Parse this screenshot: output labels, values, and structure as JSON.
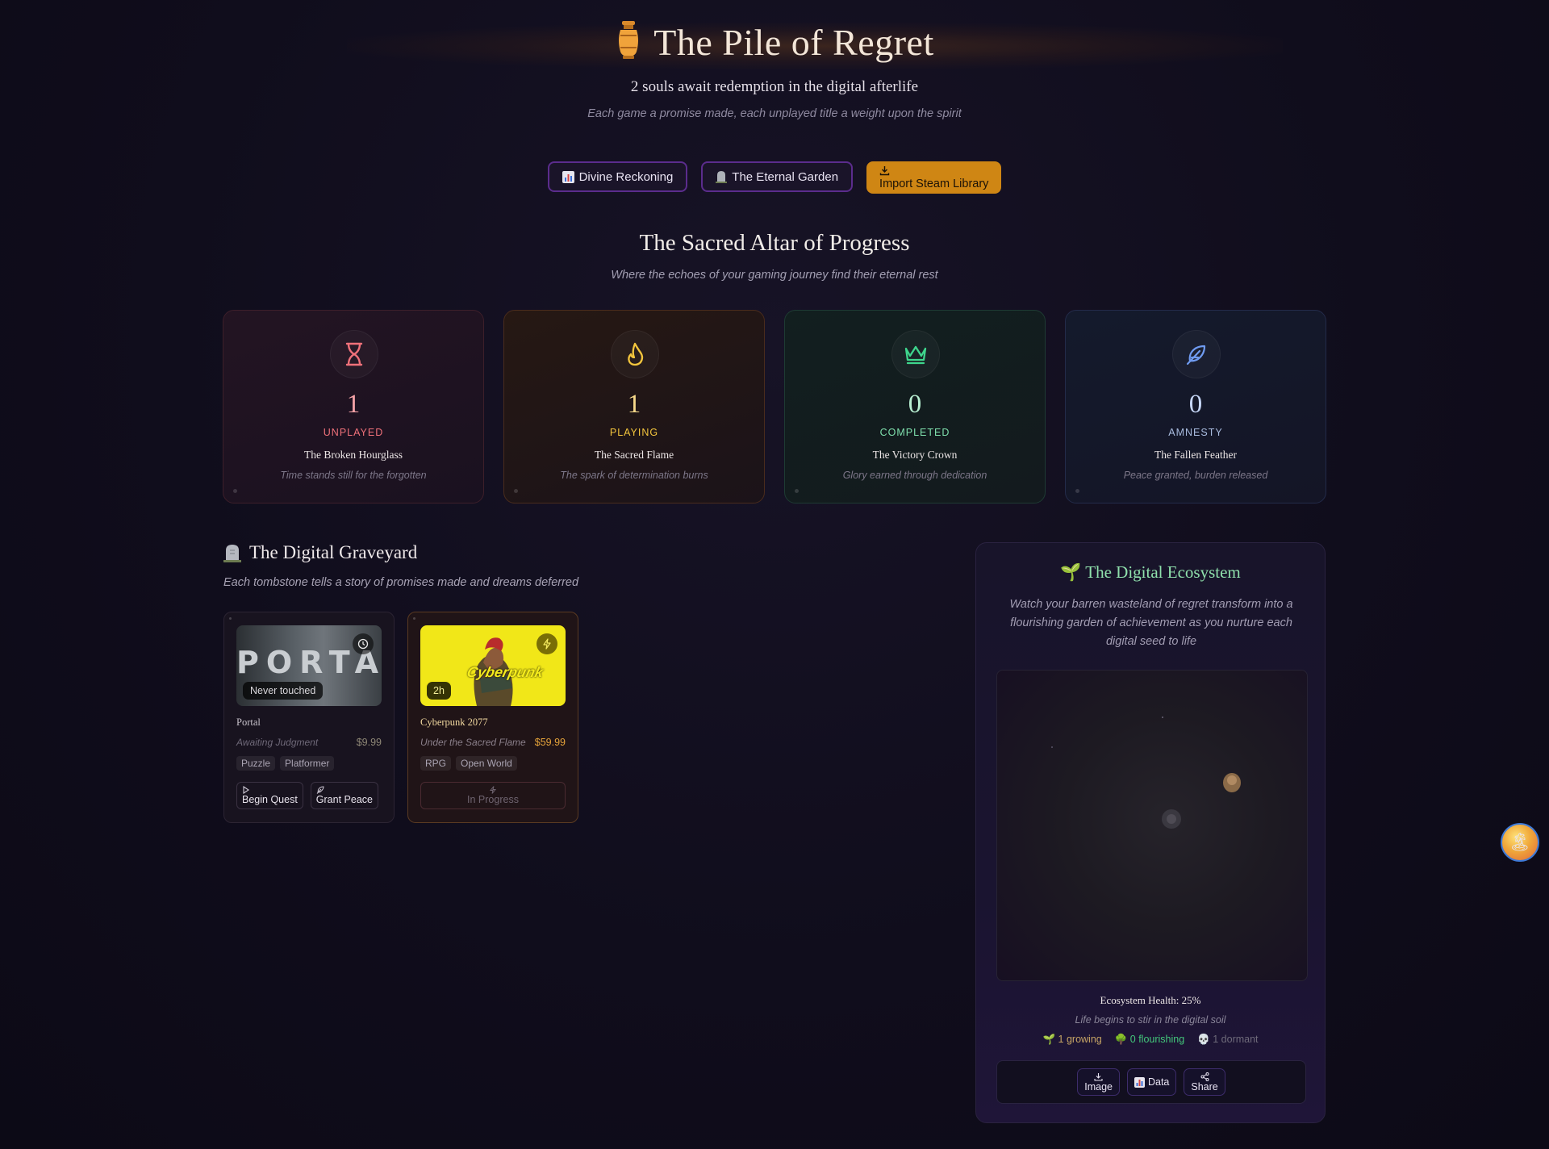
{
  "header": {
    "title": "The Pile of Regret",
    "subtitle": "2 souls await redemption in the digital afterlife",
    "tagline": "Each game a promise made, each unplayed title a weight upon the spirit"
  },
  "top_buttons": {
    "reckoning": "Divine Reckoning",
    "garden": "The Eternal Garden",
    "import": "Import Steam Library"
  },
  "altar": {
    "title": "The Sacred Altar of Progress",
    "subtitle": "Where the echoes of your gaming journey find their eternal rest"
  },
  "stats": [
    {
      "count": "1",
      "label": "UNPLAYED",
      "name": "The Broken Hourglass",
      "desc": "Time stands still for the forgotten",
      "icon": "hourglass-icon",
      "color": "#f0717a"
    },
    {
      "count": "1",
      "label": "PLAYING",
      "name": "The Sacred Flame",
      "desc": "The spark of determination burns",
      "icon": "flame-icon",
      "color": "#f4c63d"
    },
    {
      "count": "0",
      "label": "COMPLETED",
      "name": "The Victory Crown",
      "desc": "Glory earned through dedication",
      "icon": "crown-icon",
      "color": "#3ed68d"
    },
    {
      "count": "0",
      "label": "AMNESTY",
      "name": "The Fallen Feather",
      "desc": "Peace granted, burden released",
      "icon": "feather-icon",
      "color": "#6f9bf0"
    }
  ],
  "graveyard": {
    "title": "The Digital Graveyard",
    "subtitle": "Each tombstone tells a story of promises made and dreams deferred",
    "games": [
      {
        "name": "Portal",
        "status": "Awaiting Judgment",
        "price": "$9.99",
        "thumb_text": "PORTAL",
        "pill": "Never touched",
        "tags": [
          "Puzzle",
          "Platformer"
        ],
        "actions": [
          "Begin Quest",
          "Grant Peace"
        ]
      },
      {
        "name": "Cyberpunk 2077",
        "status": "Under the Sacred Flame",
        "price": "$59.99",
        "thumb_text": "Cyberpunk",
        "pill": "2h",
        "tags": [
          "RPG",
          "Open World"
        ],
        "progress": "In Progress"
      }
    ]
  },
  "ecosystem": {
    "title": "The Digital Ecosystem",
    "description": "Watch your barren wasteland of regret transform into a flourishing garden of achievement as you nurture each digital seed to life",
    "health": "Ecosystem Health: 25%",
    "life": "Life begins to stir in the digital soil",
    "growing": "1 growing",
    "flourishing": "0 flourishing",
    "dormant": "1 dormant",
    "buttons": {
      "image": "Image",
      "data": "Data",
      "share": "Share"
    }
  },
  "colors": {
    "accent_gold": "#cf8614",
    "accent_purple": "#5b2c8d",
    "eco_green": "#8fe0ac"
  }
}
